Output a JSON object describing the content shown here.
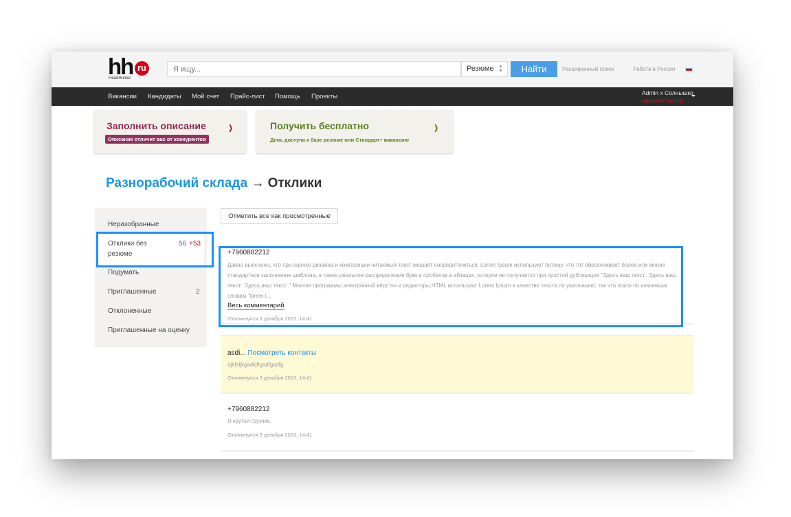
{
  "header": {
    "logo_text": "hh",
    "logo_badge": "ru",
    "logo_sub": "HeadHunter",
    "search_placeholder": "Я ищу...",
    "search_type": "Резюме",
    "search_button": "Найти",
    "advanced_search": "Расширенный поиск",
    "region": "Работа в России",
    "flag_icon": "russia-flag-icon"
  },
  "nav": {
    "items": [
      "Вакансии",
      "Кандидаты",
      "Мой счет",
      "Прайс-лист",
      "Помощь",
      "Проекты"
    ],
    "user_name": "Admin x Солнышко",
    "user_role": "администратор"
  },
  "banners": [
    {
      "title": "Заполнить описание",
      "subtitle": "Описание отличит вас от конкурентов",
      "chevron": "›",
      "color": "#8f2752"
    },
    {
      "title": "Получить бесплатно",
      "subtitle": "День доступа к базе резюме или Стандарт+ вакансию",
      "chevron": "›",
      "color": "#5a7f1f"
    }
  ],
  "page": {
    "crumb": "Разнорабочий склада",
    "arrow": "→",
    "title": "Отклики"
  },
  "sidebar": {
    "items": [
      {
        "label": "Неразобранные",
        "count": "",
        "new_count": ""
      },
      {
        "label": "Отклики без резюме",
        "count": "56",
        "new_count": "+53"
      },
      {
        "label": "Подумать",
        "count": "",
        "new_count": ""
      },
      {
        "label": "Приглашенные",
        "count": "2",
        "new_count": ""
      },
      {
        "label": "Отклоненные",
        "count": "",
        "new_count": ""
      },
      {
        "label": "Приглашенные на оценку",
        "count": "",
        "new_count": ""
      }
    ]
  },
  "main": {
    "mark_all_button": "Отметить все как просмотренные",
    "responses": [
      {
        "name": "+7960882212",
        "text": "Давно выяснено, что при оценке дизайна и композиции читаемый текст мешает сосредоточиться. Lorem Ipsum используют потому, что тот обеспечивает более или менее стандартное заполнение шаблона, а также реальное распределение букв и пробелов в абзацах, которое не получается при простой дубликации \"Здесь ваш текст.. Здесь ваш текст.. Здесь ваш текст..\" Многие программы электронной вёрстки и редакторы HTML используют Lorem Ipsum в качестве текста по умолчанию, так что поиск по ключевым словам \"lorem i...",
        "link": "Весь комментарий",
        "date": "Откликнулся 3 декабря 2015, 14:41"
      },
      {
        "name": "asdi...",
        "contacts_link": "Посмотреть контакты",
        "text": "djkfsljkgsdkjflgsdfgsdfg",
        "date": "Откликнулся 3 декабря 2015, 14:41"
      },
      {
        "name": "+7960882212",
        "text": "Я крутой грузчик.",
        "date": "Откликнулся 3 декабря 2015, 14:41"
      }
    ]
  },
  "colors": {
    "accent": "#4a9de7",
    "highlight": "#1a8fff",
    "nav_bg": "#2b2b2b",
    "new_badge": "#d6001c",
    "unread_bg": "#fffad6"
  }
}
